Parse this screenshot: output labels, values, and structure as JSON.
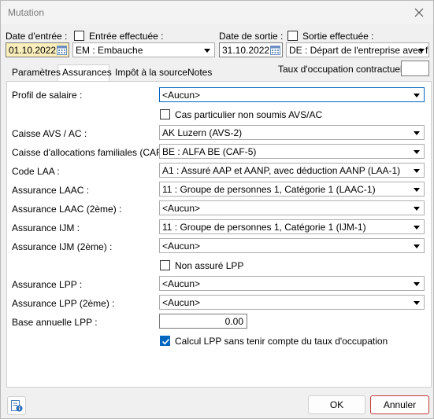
{
  "window": {
    "title": "Mutation"
  },
  "entry": {
    "date_label": "Date d'entrée :",
    "date_value": "01.10.2022",
    "done_label": "Entrée effectuée :",
    "done_checked": false,
    "reason_value": "EM : Embauche"
  },
  "exit": {
    "date_label": "Date de sortie :",
    "date_value": "31.10.2022",
    "done_label": "Sortie effectuée :",
    "done_checked": false,
    "reason_value": "DE : Départ de l'entreprise avec f"
  },
  "occupation": {
    "label": "Taux d'occupation contractuel :",
    "value": ""
  },
  "tabs": [
    {
      "label": "Paramètres",
      "active": false
    },
    {
      "label": "Assurances",
      "active": true
    },
    {
      "label": "Impôt à la source",
      "active": false
    },
    {
      "label": "Notes",
      "active": false
    }
  ],
  "form": {
    "salary_profile": {
      "label": "Profil de salaire :",
      "value": "<Aucun>"
    },
    "special_case": {
      "label": "Cas particulier non soumis AVS/AC",
      "checked": false
    },
    "avs": {
      "label": "Caisse AVS / AC :",
      "value": "AK Luzern (AVS-2)"
    },
    "caf": {
      "label": "Caisse d'allocations familiales (CAF) :",
      "value": "BE : ALFA BE (CAF-5)"
    },
    "laa": {
      "label": "Code LAA :",
      "value": "A1 : Assuré AAP et AANP, avec déduction AANP (LAA-1)"
    },
    "laac": {
      "label": "Assurance LAAC :",
      "value": "11 : Groupe de personnes 1, Catégorie 1 (LAAC-1)"
    },
    "laac2": {
      "label": "Assurance LAAC (2ème) :",
      "value": "<Aucun>"
    },
    "ijm": {
      "label": "Assurance IJM :",
      "value": "11 : Groupe de personnes 1, Catégorie 1 (IJM-1)"
    },
    "ijm2": {
      "label": "Assurance IJM (2ème) :",
      "value": "<Aucun>"
    },
    "not_lpp": {
      "label": "Non assuré LPP",
      "checked": false
    },
    "lpp": {
      "label": "Assurance LPP :",
      "value": "<Aucun>"
    },
    "lpp2": {
      "label": "Assurance LPP (2ème) :",
      "value": "<Aucun>"
    },
    "lpp_base": {
      "label": "Base annuelle LPP :",
      "value": "0.00"
    },
    "lpp_calc": {
      "label": "Calcul LPP sans tenir compte du taux d'occupation",
      "checked": true
    }
  },
  "buttons": {
    "ok": "OK",
    "cancel": "Annuler"
  },
  "colors": {
    "accent": "#0067c0",
    "date_highlight": "#fbefbb",
    "cancel_border": "#c23b3b"
  }
}
